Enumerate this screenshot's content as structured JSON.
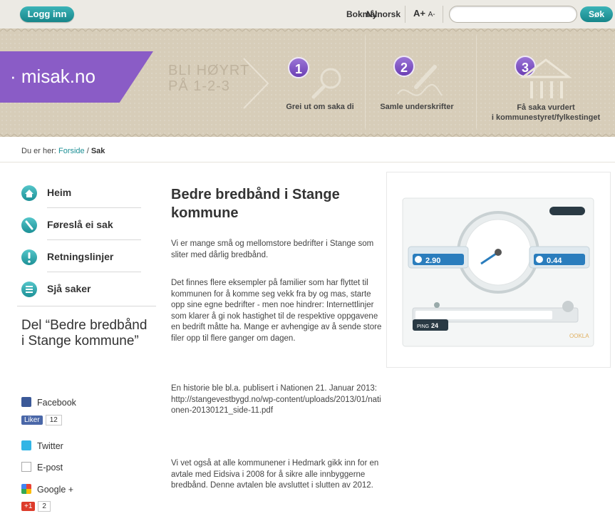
{
  "header": {
    "login_label": "Logg inn",
    "lang_bokmal": "Bokmål",
    "lang_nynorsk": "Nynorsk",
    "font_bigger": "A+",
    "font_smaller": "A-",
    "search_placeholder": "",
    "search_label": "Søk"
  },
  "banner": {
    "logo": "· misak.no",
    "tagline_line1": "BLI HØYRT",
    "tagline_line2": "PÅ 1-2-3",
    "steps": [
      {
        "num": "1",
        "label": "Grei ut om saka di"
      },
      {
        "num": "2",
        "label": "Samle underskrifter"
      },
      {
        "num": "3",
        "label_line1": "Få saka vurdert",
        "label_line2": "i kommunestyret/fylkestinget"
      }
    ]
  },
  "breadcrumb": {
    "prefix": "Du er her:",
    "home": "Forside",
    "separator": " / ",
    "current": "Sak"
  },
  "sidebar": {
    "nav": [
      {
        "label": "Heim"
      },
      {
        "label": "Føreslå ei sak"
      },
      {
        "label": "Retningslinjer"
      },
      {
        "label": "Sjå saker"
      }
    ],
    "share_title": "Del “Bedre bredbånd i Stange kommune”",
    "share": {
      "facebook": "Facebook",
      "fb_like": "Liker",
      "fb_count": "12",
      "twitter": "Twitter",
      "email": "E-post",
      "google": "Google +",
      "gplus_btn": "+1",
      "gplus_count": "2"
    }
  },
  "article": {
    "title": "Bedre bredbånd i Stange kommune",
    "p1": "Vi er mange små og mellomstore bedrifter i Stange som sliter med dårlig bredbånd.",
    "p2": "Det finnes flere eksempler på familier som har flyttet til kommunen for å komme seg vekk fra by og mas, starte opp sine egne bedrifter - men noe hindrer: Internettlinjer som klarer å gi nok hastighet til de respektive oppgavene en bedrift måtte ha. Mange er avhengige av å sende store filer opp til flere ganger om dagen.",
    "p3a": "En historie ble bl.a. publisert i Nationen 21. Januar 2013:",
    "p3b": "http://stangevestbygd.no/wp-content/uploads/2013/01/nationen-20130121_side-11.pdf",
    "p4": "Vi vet også at alle kommunener i Hedmark gikk inn for en avtale med Eidsiva i 2008 for å sikre alle innbyggerne bredbånd. Denne avtalen ble avsluttet i slutten av 2012."
  },
  "speedtest": {
    "download": "2.90",
    "upload": "0.44",
    "ping": "24",
    "ping_label": "PING",
    "brand": "OOKLA"
  }
}
